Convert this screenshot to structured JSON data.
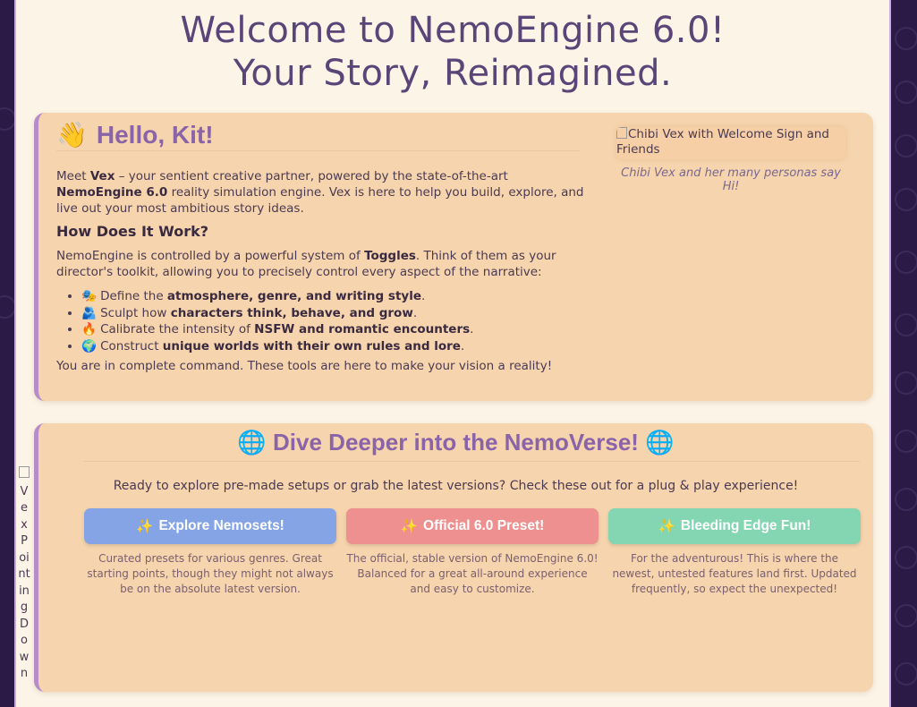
{
  "header": {
    "line1": "Welcome to NemoEngine 6.0!",
    "line2": "Your Story, Reimagined."
  },
  "hello_card": {
    "wave": "👋",
    "title": "Hello, Kit!",
    "intro_pre": "Meet ",
    "intro_vex": "Vex",
    "intro_mid": " – your sentient creative partner, powered by the state-of-the-art ",
    "intro_engine": "NemoEngine 6.0",
    "intro_post": " reality simulation engine. Vex is here to help you build, explore, and live out your most ambitious story ideas.",
    "how_title": "How Does It Work?",
    "how_pre": "NemoEngine is controlled by a powerful system of ",
    "how_toggles": "Toggles",
    "how_post": ". Think of them as your director's toolkit, allowing you to precisely control every aspect of the narrative:",
    "features": [
      {
        "icon": "🎭",
        "pre": "Define the ",
        "bold": "atmosphere, genre, and writing style",
        "post": "."
      },
      {
        "icon": "🫂",
        "pre": "Sculpt how ",
        "bold": "characters think, behave, and grow",
        "post": "."
      },
      {
        "icon": "🔥",
        "pre": "Calibrate the intensity of ",
        "bold": "NSFW and romantic encounters",
        "post": "."
      },
      {
        "icon": "🌍",
        "pre": "Construct ",
        "bold": "unique worlds with their own rules and lore",
        "post": "."
      }
    ],
    "outro": "You are in complete command. These tools are here to make your vision a reality!",
    "image_alt": "Chibi Vex with Welcome Sign and Friends",
    "image_caption": "Chibi Vex and her many personas say Hi!"
  },
  "deeper_card": {
    "globe": "🌐",
    "title": "Dive Deeper into the NemoVerse!",
    "intro": "Ready to explore pre-made setups or grab the latest versions? Check these out for a plug & play experience!",
    "buttons": [
      {
        "icon": "✨",
        "label": "Explore Nemosets!",
        "desc": "Curated presets for various genres. Great starting points, though they might not always be on the absolute latest version."
      },
      {
        "icon": "✨",
        "label": "Official 6.0 Preset!",
        "desc": "The official, stable version of NemoEngine 6.0! Balanced for a great all-around experience and easy to customize."
      },
      {
        "icon": "✨",
        "label": "Bleeding Edge Fun!",
        "desc": "For the adventurous! This is where the newest, untested features land first. Updated frequently, so expect the unexpected!"
      }
    ]
  },
  "side_image_alt": "Vex Pointing Down"
}
